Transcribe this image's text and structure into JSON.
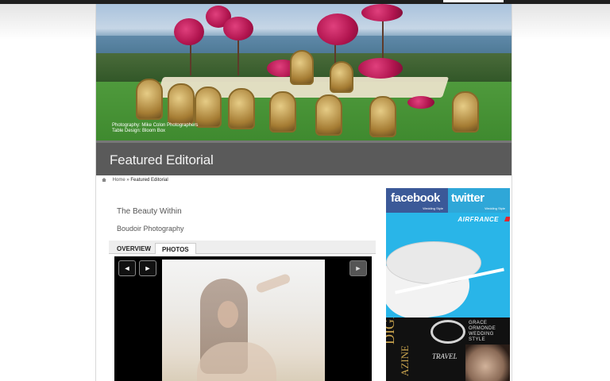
{
  "hero": {
    "credit_line1": "Photography: Mike Colon Photographers",
    "credit_line2": "Table Design: Bloom Box"
  },
  "page": {
    "title": "Featured Editorial"
  },
  "breadcrumb": {
    "home": "Home",
    "separator": "»",
    "current": "Featured Editorial"
  },
  "article": {
    "title": "The Beauty Within",
    "subtitle": "Boudoir Photography"
  },
  "tabs": [
    {
      "label": "OVERVIEW",
      "active": false
    },
    {
      "label": "PHOTOS",
      "active": true
    }
  ],
  "gallery": {
    "prev_icon": "◄",
    "next_icon": "►",
    "play_icon": "►"
  },
  "sidebar": {
    "facebook": {
      "brand": "facebook",
      "tag": "Wedding Style"
    },
    "twitter": {
      "brand": "twitter",
      "tag": "Wedding Style"
    },
    "airfrance": {
      "logo": "AIRFRANCE"
    },
    "magazine": {
      "vertical_text": "DIGITAL",
      "vertical_text2": "AZINE",
      "title_lines": [
        "GRACE",
        "ORMONDE",
        "WEDDING",
        "STYLE"
      ],
      "feature": "TRAVEL"
    }
  },
  "colors": {
    "title_band": "#5a5a5a",
    "facebook": "#3b5998",
    "twitter": "#2fa7d8",
    "airfrance_bg": "#29b5e8"
  }
}
